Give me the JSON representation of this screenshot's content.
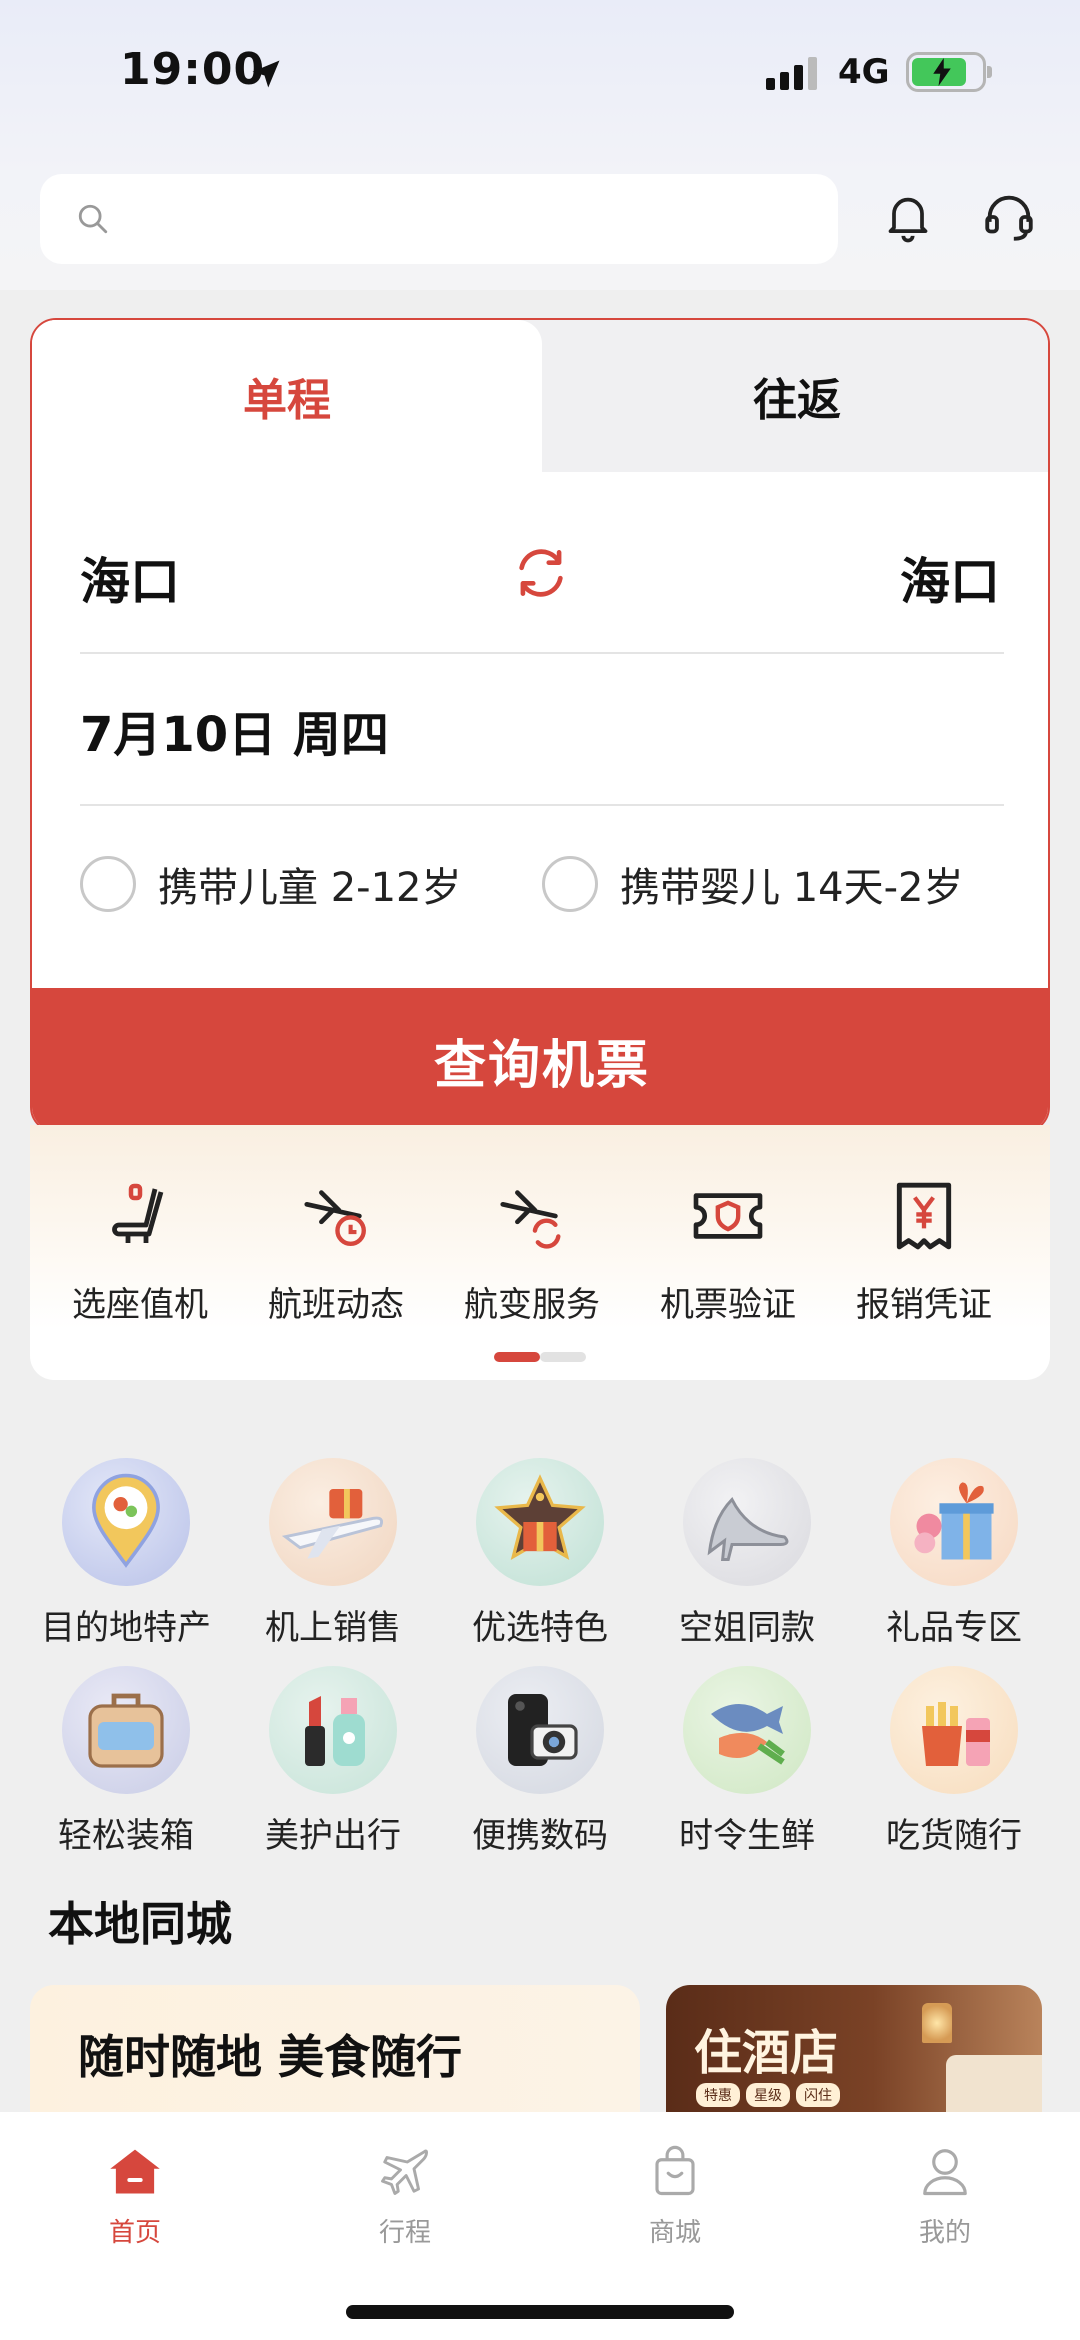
{
  "status_bar": {
    "time": "19:00",
    "network": "4G",
    "battery_level": 0.8
  },
  "search": {
    "placeholder": ""
  },
  "booking": {
    "tabs": [
      "单程",
      "往返"
    ],
    "active_tab": "单程",
    "from_city": "海口",
    "to_city": "海口",
    "date": "7月10日 周四",
    "options": [
      {
        "label": "携带儿童 2-12岁",
        "checked": false
      },
      {
        "label": "携带婴儿 14天-2岁",
        "checked": false
      }
    ],
    "query_label": "查询机票"
  },
  "services": [
    {
      "label": "选座值机",
      "icon": "seat-icon"
    },
    {
      "label": "航班动态",
      "icon": "flight-status-icon"
    },
    {
      "label": "航变服务",
      "icon": "flight-change-icon"
    },
    {
      "label": "机票验证",
      "icon": "ticket-verify-icon"
    },
    {
      "label": "报销凭证",
      "icon": "receipt-icon"
    }
  ],
  "shop": [
    {
      "label": "目的地特产",
      "icon": "location-food-icon"
    },
    {
      "label": "机上销售",
      "icon": "airplane-gift-icon"
    },
    {
      "label": "优选特色",
      "icon": "star-gift-icon"
    },
    {
      "label": "空姐同款",
      "icon": "high-heel-icon"
    },
    {
      "label": "礼品专区",
      "icon": "gift-box-icon"
    },
    {
      "label": "轻松装箱",
      "icon": "suitcase-icon"
    },
    {
      "label": "美护出行",
      "icon": "cosmetics-icon"
    },
    {
      "label": "便携数码",
      "icon": "camera-phone-icon"
    },
    {
      "label": "时令生鲜",
      "icon": "fresh-food-icon"
    },
    {
      "label": "吃货随行",
      "icon": "snacks-icon"
    }
  ],
  "local": {
    "title": "本地同城",
    "food_title": "随时随地 美食随行",
    "hotel_title": "住酒店",
    "hotel_tags": [
      "特惠",
      "星级",
      "闪住"
    ]
  },
  "tabbar": [
    {
      "label": "首页",
      "active": true
    },
    {
      "label": "行程",
      "active": false
    },
    {
      "label": "商城",
      "active": false
    },
    {
      "label": "我的",
      "active": false
    }
  ],
  "colors": {
    "accent": "#d6473d"
  }
}
